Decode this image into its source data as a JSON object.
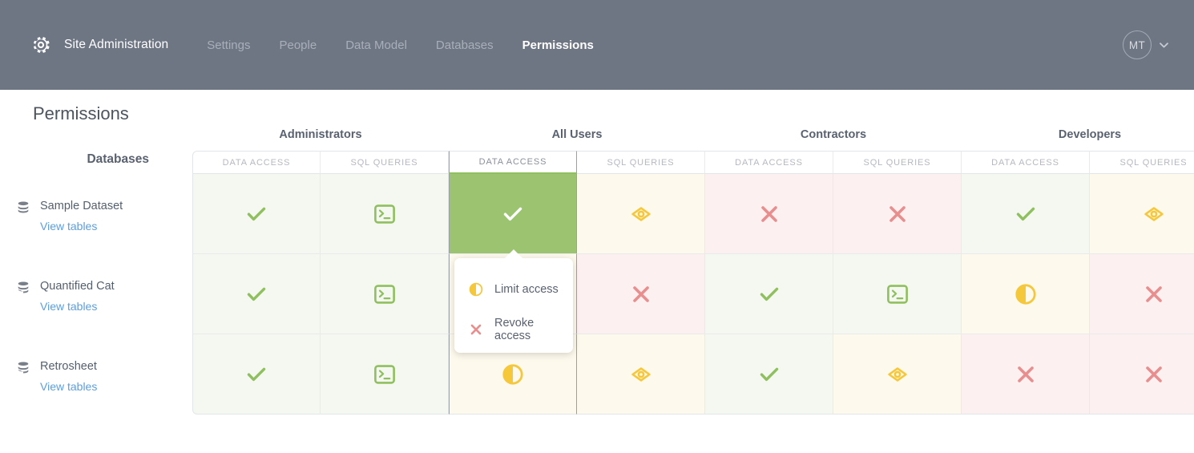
{
  "header": {
    "brand": "Site Administration",
    "brand_icon": "gear-icon",
    "nav": [
      {
        "label": "Settings",
        "active": false
      },
      {
        "label": "People",
        "active": false
      },
      {
        "label": "Data Model",
        "active": false
      },
      {
        "label": "Databases",
        "active": false
      },
      {
        "label": "Permissions",
        "active": true
      }
    ],
    "avatar_initials": "MT",
    "avatar_chevron": "chevron-down-icon",
    "bg_color": "#6E7684"
  },
  "page": {
    "title": "Permissions"
  },
  "sidebar": {
    "heading": "Databases",
    "databases": [
      {
        "name": "Sample Dataset",
        "link": "View tables",
        "icon": "database-icon"
      },
      {
        "name": "Quantified Cat",
        "link": "View tables",
        "icon": "database-icon"
      },
      {
        "name": "Retrosheet",
        "link": "View tables",
        "icon": "database-icon"
      }
    ]
  },
  "grid": {
    "groups": [
      "Administrators",
      "All Users",
      "Contractors",
      "Developers"
    ],
    "subcolumns": [
      "DATA ACCESS",
      "SQL QUERIES"
    ],
    "selected_column_index": 2,
    "rows": [
      {
        "database": "Sample Dataset",
        "cells": [
          {
            "state": "granted",
            "icon": "check-icon",
            "bg": "#F4F8F0"
          },
          {
            "state": "granted",
            "icon": "terminal-icon",
            "bg": "#F4F8F0"
          },
          {
            "state": "active",
            "icon": "check-icon",
            "bg": "#9CC470"
          },
          {
            "state": "limited",
            "icon": "eye-icon",
            "bg": "#FDF9EC"
          },
          {
            "state": "revoked",
            "icon": "x-icon",
            "bg": "#FDF0F1"
          },
          {
            "state": "revoked",
            "icon": "x-icon",
            "bg": "#FDF0F1"
          },
          {
            "state": "granted",
            "icon": "check-icon",
            "bg": "#F4F8F0"
          },
          {
            "state": "limited",
            "icon": "eye-icon",
            "bg": "#FDF9EC"
          }
        ]
      },
      {
        "database": "Quantified Cat",
        "cells": [
          {
            "state": "granted",
            "icon": "check-icon",
            "bg": "#F4F8F0"
          },
          {
            "state": "granted",
            "icon": "terminal-icon",
            "bg": "#F4F8F0"
          },
          {
            "state": "limited",
            "icon": "half-circle-icon",
            "bg": "#FDF9EC"
          },
          {
            "state": "revoked",
            "icon": "x-icon",
            "bg": "#FDF0F1"
          },
          {
            "state": "granted",
            "icon": "check-icon",
            "bg": "#F4F8F0"
          },
          {
            "state": "granted",
            "icon": "terminal-icon",
            "bg": "#F4F8F0"
          },
          {
            "state": "limited",
            "icon": "half-circle-icon",
            "bg": "#FDF9EC"
          },
          {
            "state": "revoked",
            "icon": "x-icon",
            "bg": "#FDF0F1"
          }
        ]
      },
      {
        "database": "Retrosheet",
        "cells": [
          {
            "state": "granted",
            "icon": "check-icon",
            "bg": "#F4F8F0"
          },
          {
            "state": "granted",
            "icon": "terminal-icon",
            "bg": "#F4F8F0"
          },
          {
            "state": "limited",
            "icon": "half-circle-icon",
            "bg": "#FDF9EC"
          },
          {
            "state": "limited",
            "icon": "eye-icon",
            "bg": "#FDF9EC"
          },
          {
            "state": "granted",
            "icon": "check-icon",
            "bg": "#F4F8F0"
          },
          {
            "state": "limited",
            "icon": "eye-icon",
            "bg": "#FDF9EC"
          },
          {
            "state": "revoked",
            "icon": "x-icon",
            "bg": "#FDF0F1"
          },
          {
            "state": "revoked",
            "icon": "x-icon",
            "bg": "#FDF0F1"
          }
        ]
      }
    ]
  },
  "popup": {
    "items": [
      {
        "label": "Limit access",
        "icon": "half-circle-icon"
      },
      {
        "label": "Revoke access",
        "icon": "x-icon"
      }
    ]
  },
  "colors": {
    "nav_bg": "#6E7684",
    "active_cell": "#9CC470",
    "green": "#8FBF5E",
    "yellow": "#F5C83B",
    "red": "#E98E8E",
    "link": "#5A9FE0"
  }
}
